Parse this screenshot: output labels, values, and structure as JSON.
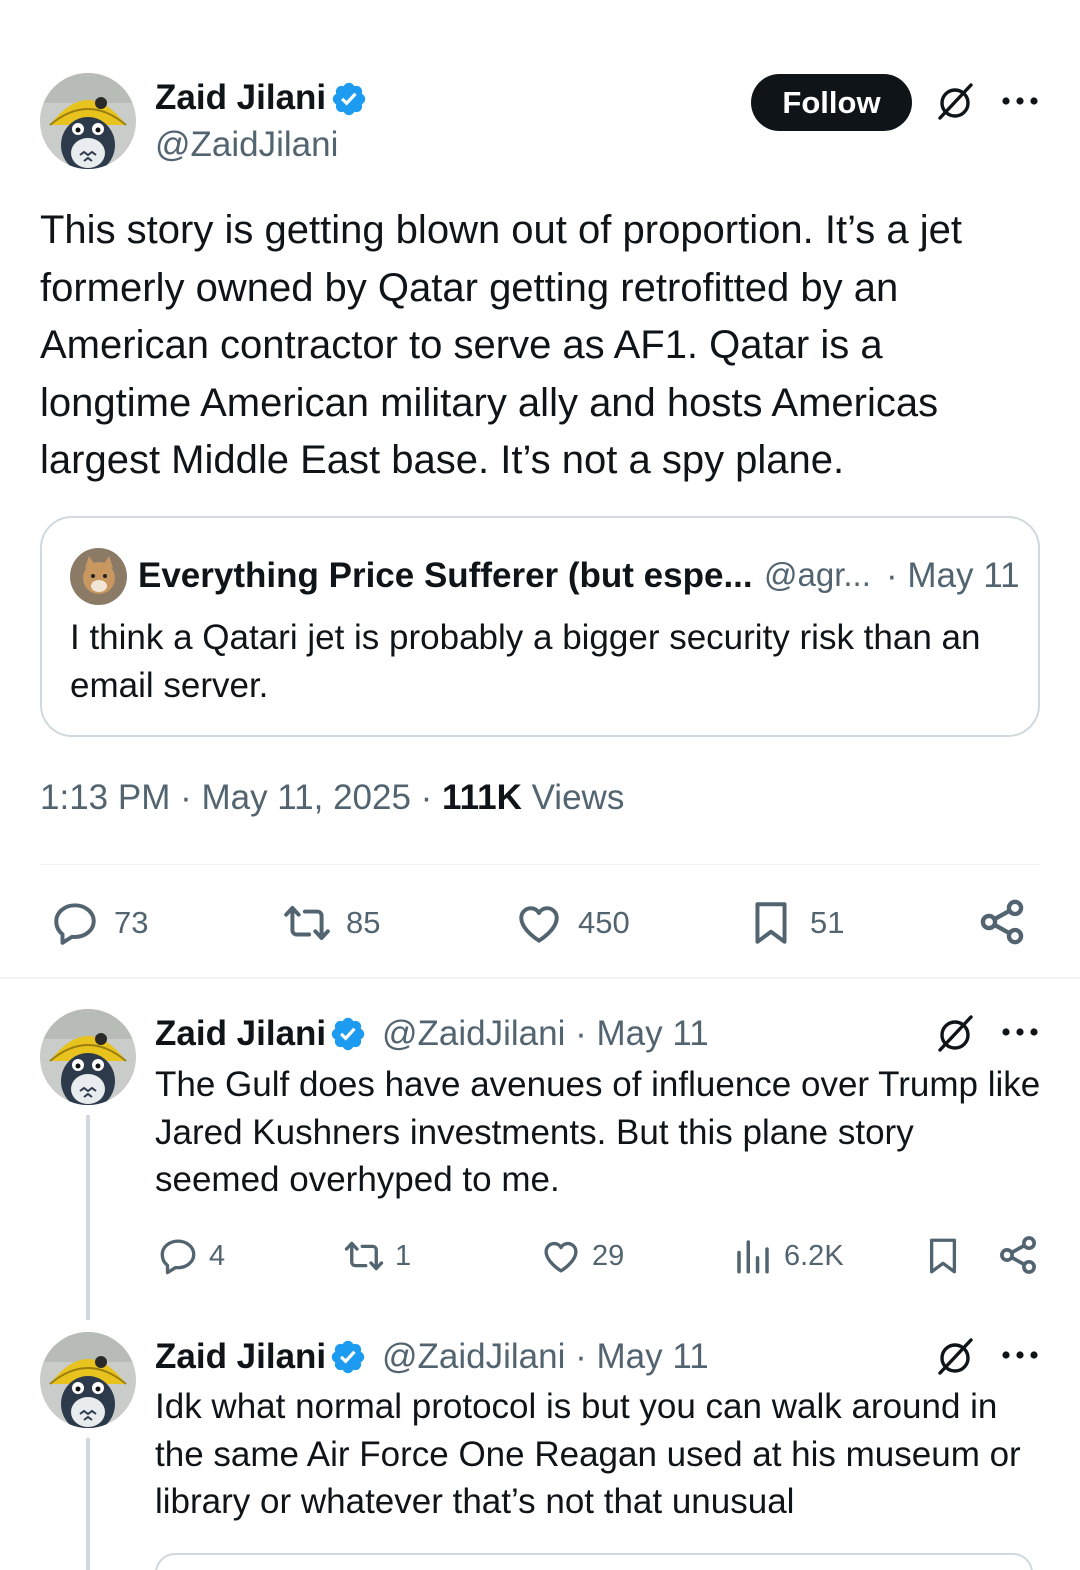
{
  "main_tweet": {
    "author_name": "Zaid Jilani",
    "handle": "@ZaidJilani",
    "follow_label": "Follow",
    "text": "This story is getting blown out of proportion. It’s a jet formerly owned by Qatar getting retrofitted by an American contractor to serve as AF1. Qatar is a longtime American military ally and hosts Americas largest Middle East base. It’s not a spy plane.",
    "quote": {
      "author_name": "Everything Price Sufferer (but espe...",
      "handle": "@agr...",
      "date": "· May 11",
      "text": "I think a Qatari jet is probably a bigger security risk than an email server."
    },
    "timestamp": "1:13 PM · May 11, 2025 · ",
    "views_count": "111K",
    "views_label": " Views",
    "stats": {
      "replies": "73",
      "reposts": "85",
      "likes": "450",
      "bookmarks": "51"
    }
  },
  "replies": [
    {
      "author_name": "Zaid Jilani",
      "handle_date": "@ZaidJilani · May 11",
      "text": "The Gulf does have avenues of influence over Trump like Jared Kushners investments. But this plane story seemed overhyped to me.",
      "stats": {
        "replies": "4",
        "reposts": "1",
        "likes": "29",
        "views": "6.2K"
      }
    },
    {
      "author_name": "Zaid Jilani",
      "handle_date": "@ZaidJilani · May 11",
      "text": "Idk what normal protocol is but you can walk around in the same Air Force One Reagan used at his museum or library or whatever that’s not that unusual"
    }
  ],
  "colors": {
    "text_primary": "#0f1419",
    "text_secondary": "#536471",
    "verified_blue": "#1d9bf0",
    "border": "#cfd9de"
  },
  "icons": [
    "verified-badge-icon",
    "grok-icon",
    "more-icon",
    "reply-icon",
    "repost-icon",
    "like-icon",
    "bookmark-icon",
    "share-icon",
    "views-icon"
  ]
}
